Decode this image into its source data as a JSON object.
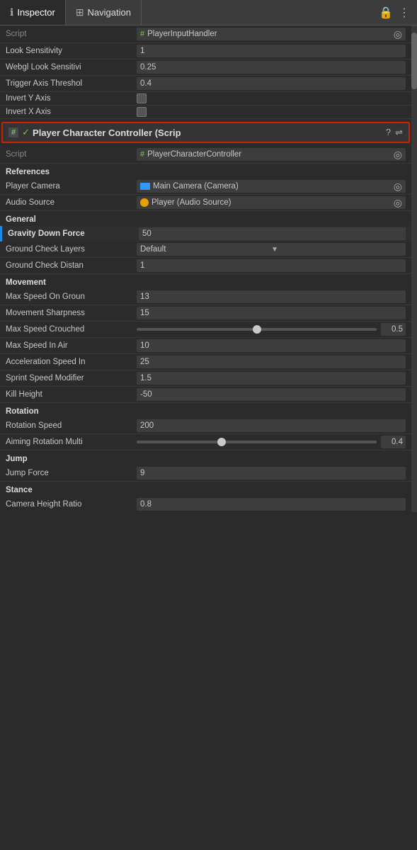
{
  "tabs": [
    {
      "label": "Inspector",
      "icon": "ℹ",
      "active": true
    },
    {
      "label": "Navigation",
      "icon": "⊞",
      "active": false
    }
  ],
  "tab_actions": [
    "🔒",
    "⋮"
  ],
  "playerInputHandler": {
    "component_label": "Script",
    "component_value": "PlayerInputHandler",
    "fields": [
      {
        "label": "Look Sensitivity",
        "value": "1"
      },
      {
        "label": "Webgl Look Sensitivi",
        "value": "0.25"
      },
      {
        "label": "Trigger Axis Threshol",
        "value": "0.4"
      },
      {
        "label": "Invert Y Axis",
        "type": "checkbox",
        "checked": false
      },
      {
        "label": "Invert X Axis",
        "type": "checkbox",
        "checked": false
      }
    ]
  },
  "playerCharacterController": {
    "header_title": "Player Character Controller (Scrip",
    "script_label": "Script",
    "script_value": "PlayerCharacterController",
    "sections": {
      "references": {
        "title": "References",
        "fields": [
          {
            "label": "Player Camera",
            "type": "ref_camera",
            "value": "Main Camera (Camera)"
          },
          {
            "label": "Audio Source",
            "type": "ref_audio",
            "value": "Player (Audio Source)"
          }
        ]
      },
      "general": {
        "title": "General",
        "fields": [
          {
            "label": "Gravity Down Force",
            "value": "50"
          },
          {
            "label": "Ground Check Layers",
            "type": "dropdown",
            "value": "Default"
          },
          {
            "label": "Ground Check Distan",
            "value": "1"
          }
        ]
      },
      "movement": {
        "title": "Movement",
        "fields": [
          {
            "label": "Max Speed On Groun",
            "value": "13"
          },
          {
            "label": "Movement Sharpness",
            "value": "15"
          },
          {
            "label": "Max Speed Crouched",
            "type": "slider",
            "slider_value": "0.5",
            "slider_position": 0.5
          },
          {
            "label": "Max Speed In Air",
            "value": "10"
          },
          {
            "label": "Acceleration Speed In",
            "value": "25"
          },
          {
            "label": "Sprint Speed Modifier",
            "value": "1.5"
          },
          {
            "label": "Kill Height",
            "value": "-50"
          }
        ]
      },
      "rotation": {
        "title": "Rotation",
        "fields": [
          {
            "label": "Rotation Speed",
            "value": "200"
          },
          {
            "label": "Aiming Rotation Multi",
            "type": "slider",
            "slider_value": "0.4",
            "slider_position": 0.35
          }
        ]
      },
      "jump": {
        "title": "Jump",
        "fields": [
          {
            "label": "Jump Force",
            "value": "9"
          }
        ]
      },
      "stance": {
        "title": "Stance",
        "fields": [
          {
            "label": "Camera Height Ratio",
            "value": "0.8"
          }
        ]
      }
    }
  }
}
